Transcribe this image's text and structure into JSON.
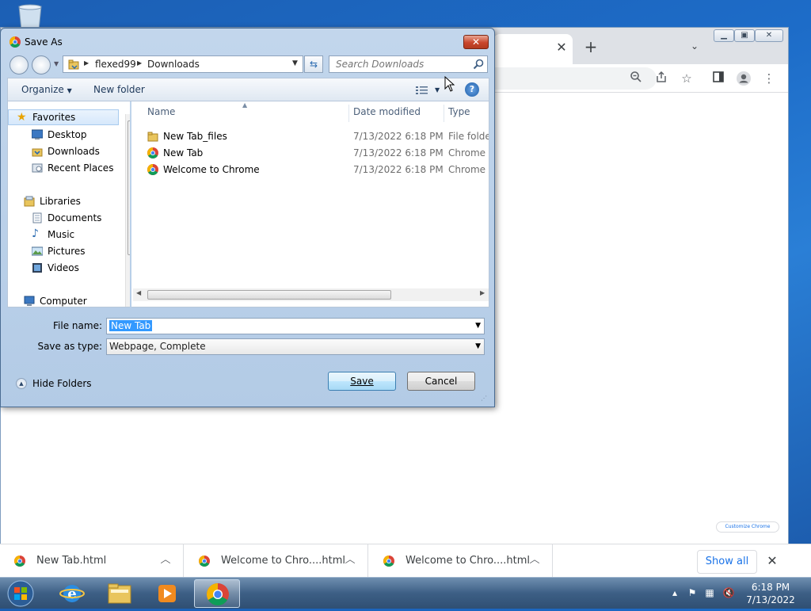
{
  "chrome": {
    "download_shelf": {
      "items": [
        {
          "name": "New Tab.html"
        },
        {
          "name": "Welcome to Chro....html"
        },
        {
          "name": "Welcome to Chro....html"
        }
      ],
      "show_all_label": "Show all"
    },
    "customize_label": "Customize Chrome"
  },
  "dialog": {
    "title": "Save As",
    "breadcrumb": [
      "flexed99",
      "Downloads"
    ],
    "search_placeholder": "Search Downloads",
    "toolbar": {
      "organize_label": "Organize",
      "new_folder_label": "New folder"
    },
    "nav": {
      "favorites": {
        "label": "Favorites",
        "items": [
          {
            "label": "Desktop"
          },
          {
            "label": "Downloads"
          },
          {
            "label": "Recent Places"
          }
        ]
      },
      "libraries": {
        "label": "Libraries",
        "items": [
          {
            "label": "Documents"
          },
          {
            "label": "Music"
          },
          {
            "label": "Pictures"
          },
          {
            "label": "Videos"
          }
        ]
      },
      "computer_label": "Computer"
    },
    "columns": {
      "name": "Name",
      "date_modified": "Date modified",
      "type": "Type"
    },
    "files": [
      {
        "name": "New Tab_files",
        "date": "7/13/2022 6:18 PM",
        "type": "File folder",
        "icon": "folder-icon"
      },
      {
        "name": "New Tab",
        "date": "7/13/2022 6:18 PM",
        "type": "Chrome H",
        "icon": "chrome-html-icon"
      },
      {
        "name": "Welcome to Chrome",
        "date": "7/13/2022 6:18 PM",
        "type": "Chrome H",
        "icon": "chrome-html-icon"
      }
    ],
    "file_name_label": "File name:",
    "file_name_value": "New Tab",
    "save_as_type_label": "Save as type:",
    "save_as_type_value": "Webpage, Complete",
    "hide_folders_label": "Hide Folders",
    "save_label": "Save",
    "cancel_label": "Cancel"
  },
  "taskbar": {
    "time": "6:18 PM",
    "date": "7/13/2022"
  }
}
